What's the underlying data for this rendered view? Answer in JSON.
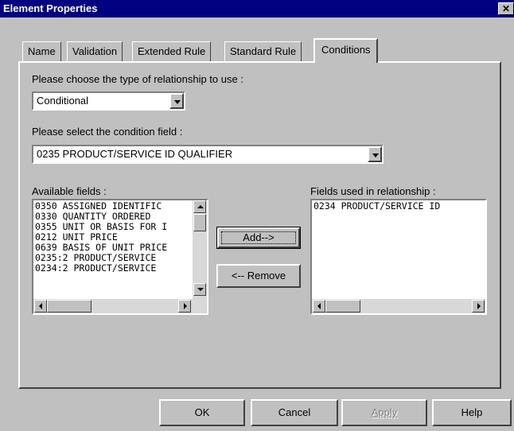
{
  "window": {
    "title": "Element Properties",
    "close_glyph": "✕"
  },
  "tabs": [
    {
      "label": "Name"
    },
    {
      "label": "Validation"
    },
    {
      "label": "Extended Rule"
    },
    {
      "label": "Standard Rule"
    },
    {
      "label": "Conditions",
      "active": true
    }
  ],
  "relationship": {
    "label": "Please choose the type of relationship to use :",
    "value": "Conditional"
  },
  "condition_field": {
    "label": "Please select the condition field :",
    "value": "0235 PRODUCT/SERVICE ID QUALIFIER"
  },
  "available_fields": {
    "label": "Available fields :",
    "items": [
      "0350 ASSIGNED IDENTIFIC",
      "0330 QUANTITY ORDERED",
      "0355 UNIT OR BASIS FOR I",
      "0212 UNIT PRICE",
      "0639 BASIS OF UNIT PRICE",
      "0235:2 PRODUCT/SERVICE",
      "0234:2 PRODUCT/SERVICE"
    ]
  },
  "used_fields": {
    "label": "Fields used in relationship :",
    "items": [
      "0234 PRODUCT/SERVICE ID"
    ]
  },
  "buttons": {
    "add": "Add-->",
    "remove": "<-- Remove",
    "ok": "OK",
    "cancel": "Cancel",
    "apply": "Apply",
    "help": "Help"
  },
  "colors": {
    "titlebar": "#000080",
    "face": "#c0c0c0"
  }
}
